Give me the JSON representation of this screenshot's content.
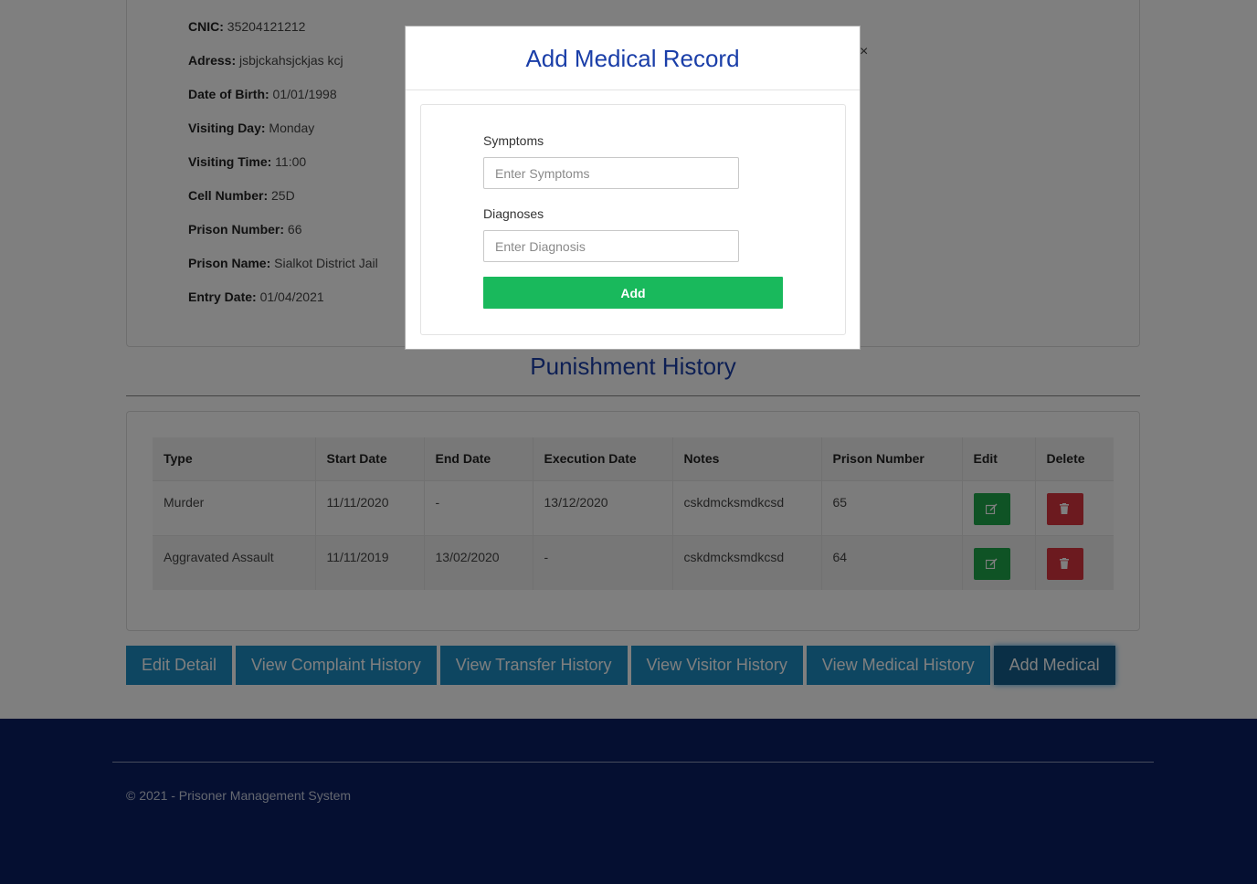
{
  "details": [
    {
      "label": "CNIC:",
      "value": " 35204121212"
    },
    {
      "label": "Adress:",
      "value": " jsbjckahsjckjas kcj"
    },
    {
      "label": "Date of Birth:",
      "value": " 01/01/1998"
    },
    {
      "label": "Visiting Day:",
      "value": " Monday"
    },
    {
      "label": "Visiting Time:",
      "value": " 11:00"
    },
    {
      "label": "Cell Number:",
      "value": " 25D"
    },
    {
      "label": "Prison Number:",
      "value": " 66"
    },
    {
      "label": "Prison Name:",
      "value": " Sialkot District Jail"
    },
    {
      "label": "Entry Date:",
      "value": " 01/04/2021"
    }
  ],
  "punishment": {
    "title": "Punishment History",
    "columns": [
      "Type",
      "Start Date",
      "End Date",
      "Execution Date",
      "Notes",
      "Prison Number",
      "Edit",
      "Delete"
    ],
    "rows": [
      [
        "Murder",
        "11/11/2020",
        "-",
        "13/12/2020",
        "cskdmcksmdkcsd",
        "65"
      ],
      [
        "Aggravated Assault",
        "11/11/2019",
        "13/02/2020",
        "-",
        "cskdmcksmdkcsd",
        "64"
      ]
    ],
    "edit_icon": "edit-icon",
    "delete_icon": "trash-icon"
  },
  "actions": [
    "Edit Detail",
    "View Complaint History",
    "View Transfer History",
    "View Visitor History",
    "View Medical History",
    "Add Medical"
  ],
  "footer": {
    "text": "© 2021 - Prisoner Management System"
  },
  "modal": {
    "title": "Add Medical Record",
    "close_label": "×",
    "symptoms_label": "Symptoms",
    "symptoms_placeholder": "Enter Symptoms",
    "diagnoses_label": "Diagnoses",
    "diagnoses_placeholder": "Enter Diagnosis",
    "submit_label": "Add"
  },
  "colors": {
    "accent": "#1a3ea8",
    "action": "#1d8dc3",
    "footer": "#0a1f63",
    "submit": "#19b95c",
    "edit": "#1fa64a",
    "delete": "#d9343f"
  }
}
